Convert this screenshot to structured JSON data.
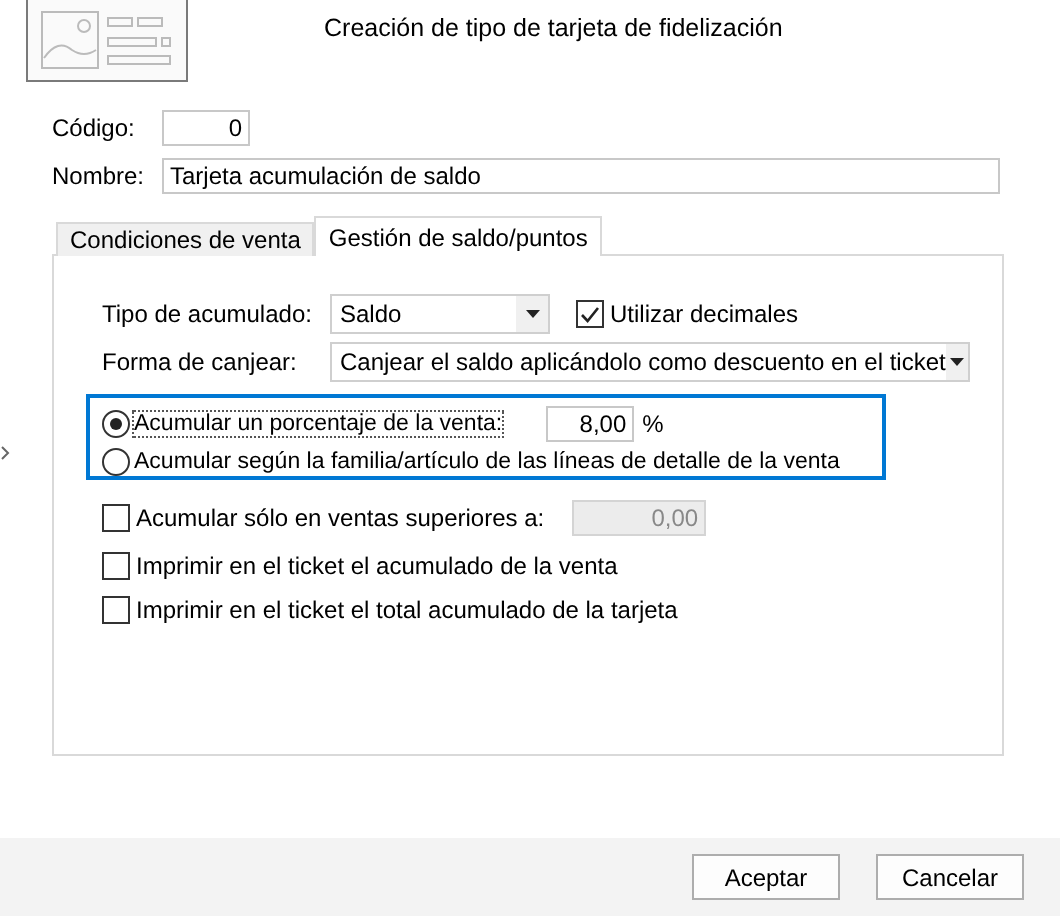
{
  "header": {
    "title": "Creación de tipo de tarjeta de fidelización",
    "image": {
      "kind": "placeholder"
    }
  },
  "fields": [
    {
      "label": "Código:",
      "value": "0",
      "kind": "short"
    },
    {
      "label": "Nombre:",
      "value": "Tarjeta acumulación de saldo",
      "kind": "wide"
    }
  ],
  "tabs": [
    {
      "label": "Condiciones de venta",
      "selected": false
    },
    {
      "label": "Gestión de saldo/puntos",
      "selected": true
    }
  ],
  "tipo_acumulado": {
    "label": "Tipo de acumulado:",
    "value": "Saldo",
    "checkbox": {
      "label": "Utilizar decimales",
      "checked": true
    }
  },
  "forma_canjear": {
    "label": "Forma de canjear:",
    "value": "Canjear el saldo aplicándolo como descuento en el ticket"
  },
  "radio_group": [
    {
      "label": "Acumular un porcentaje de la venta:",
      "selected": true,
      "focused": true,
      "value": "8,00",
      "unit": "%"
    },
    {
      "label": "Acumular según la familia/artículo de las líneas de detalle de la venta",
      "selected": false,
      "focused": false
    }
  ],
  "options": [
    {
      "label": "Acumular sólo en ventas superiores a:",
      "checked": false,
      "value": "0,00",
      "disabled": true
    },
    {
      "label": "Imprimir en el ticket el acumulado de la venta",
      "checked": false
    },
    {
      "label": "Imprimir en el ticket el total acumulado de la tarjeta",
      "checked": false
    }
  ],
  "buttons": [
    "Aceptar",
    "Cancelar"
  ]
}
